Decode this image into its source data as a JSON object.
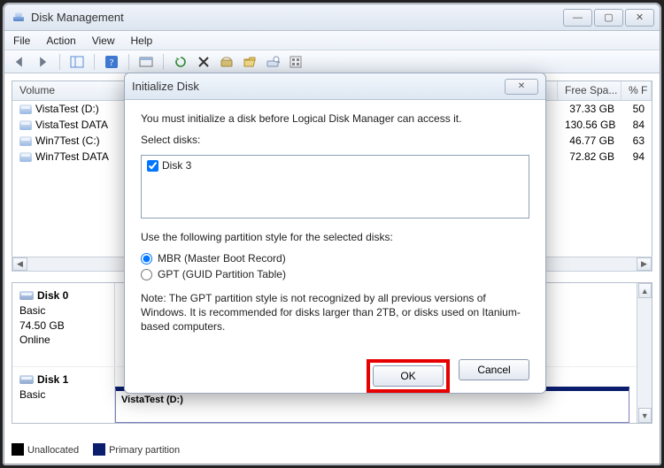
{
  "window": {
    "title": "Disk Management",
    "menu": {
      "file": "File",
      "action": "Action",
      "view": "View",
      "help": "Help"
    },
    "controls": {
      "min": "—",
      "max": "▢",
      "close": "✕"
    }
  },
  "columns": {
    "volume": "Volume",
    "freespace": "Free Spa...",
    "pct": "% F"
  },
  "volumes": [
    {
      "name": "VistaTest (D:)",
      "free": "37.33 GB",
      "pct": "50"
    },
    {
      "name": "VistaTest DATA",
      "free": "130.56 GB",
      "pct": "84"
    },
    {
      "name": "Win7Test (C:)",
      "free": "46.77 GB",
      "pct": "63"
    },
    {
      "name": "Win7Test DATA",
      "free": "72.82 GB",
      "pct": "94"
    }
  ],
  "disks": [
    {
      "name": "Disk 0",
      "type": "Basic",
      "size": "74.50 GB",
      "status": "Online"
    },
    {
      "name": "Disk 1",
      "type": "Basic",
      "size": "",
      "status": ""
    }
  ],
  "partition_visible": {
    "name": "VistaTest  (D:)"
  },
  "legend": {
    "unallocated": "Unallocated",
    "primary": "Primary partition"
  },
  "dialog": {
    "title": "Initialize Disk",
    "intro": "You must initialize a disk before Logical Disk Manager can access it.",
    "select_label": "Select disks:",
    "disks": [
      {
        "label": "Disk 3",
        "checked": true
      }
    ],
    "style_label": "Use the following partition style for the selected disks:",
    "mbr": "MBR (Master Boot Record)",
    "gpt": "GPT (GUID Partition Table)",
    "note": "Note: The GPT partition style is not recognized by all previous versions of Windows. It is recommended for disks larger than 2TB, or disks used on Itanium-based computers.",
    "ok": "OK",
    "cancel": "Cancel",
    "close_glyph": "✕"
  }
}
